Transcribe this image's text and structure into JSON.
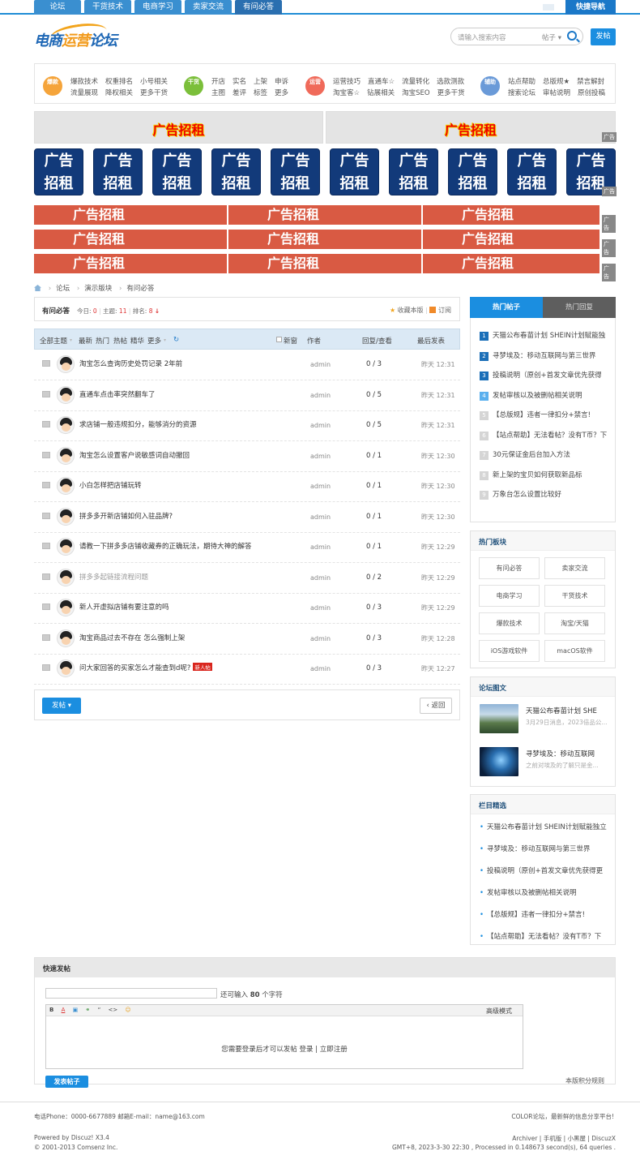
{
  "topnav": {
    "items": [
      "论坛",
      "干货技术",
      "电商学习",
      "卖家交流",
      "有问必答"
    ],
    "quick": "快捷导航"
  },
  "header": {
    "logo_part1": "电商",
    "logo_part2": "运营",
    "logo_part3": "论坛",
    "search_placeholder": "请输入搜索内容",
    "search_scope": "帖子 ▾",
    "post_button": "发帖"
  },
  "categories": [
    {
      "badge": "爆款",
      "color": "#f5a43a",
      "links": [
        "爆款技术",
        "权重排名",
        "小号相关",
        "流量展现",
        "降权相关",
        "更多干货"
      ]
    },
    {
      "badge": "干货",
      "color": "#7bbf3a",
      "links": [
        "开店",
        "实名",
        "上架",
        "申诉",
        "主图",
        "差评",
        "标签",
        "更多"
      ]
    },
    {
      "badge": "运营",
      "color": "#f06a5a",
      "links": [
        "运营技巧",
        "直通车☆",
        "流量转化",
        "选款测款",
        "淘宝客☆",
        "钻展相关",
        "淘宝SEO",
        "更多干货"
      ]
    },
    {
      "badge": "辅助",
      "color": "#6a9ad8",
      "links": [
        "站点帮助",
        "总版规★",
        "禁言解封",
        "搜索论坛",
        "审帖说明",
        "原创投稿"
      ]
    }
  ],
  "ads": {
    "text": "广告招租",
    "sq_line1": "广告",
    "sq_line2": "招租",
    "tag": "广告"
  },
  "breadcrumb": [
    "论坛",
    "演示版块",
    "有问必答"
  ],
  "forum": {
    "name": "有问必答",
    "today_label": "今日:",
    "today": "0",
    "topics_label": "主题:",
    "topics": "11",
    "rank_label": "排名:",
    "rank": "8",
    "fav": "收藏本版",
    "rss": "订阅"
  },
  "thead": {
    "all": "全部主题",
    "latest": "最新",
    "hot": "热门",
    "hotpost": "热帖",
    "digest": "精华",
    "more": "更多",
    "newwin": "新窗",
    "author": "作者",
    "reply_view": "回复/查看",
    "lastpost": "最后发表"
  },
  "threads": [
    {
      "title": "淘宝怎么查询历史处罚记录 2年前",
      "author": "admin",
      "rv": "0 / 3",
      "time": "昨天 12:31"
    },
    {
      "title": "直通车点击率突然翻车了",
      "author": "admin",
      "rv": "0 / 5",
      "time": "昨天 12:31"
    },
    {
      "title": "求店铺一般违规扣分，能够消分的资源",
      "author": "admin",
      "rv": "0 / 5",
      "time": "昨天 12:31"
    },
    {
      "title": "淘宝怎么设置客户说敏感词自动撤回",
      "author": "admin",
      "rv": "0 / 1",
      "time": "昨天 12:30"
    },
    {
      "title": "小白怎样把店铺玩转",
      "author": "admin",
      "rv": "0 / 1",
      "time": "昨天 12:30"
    },
    {
      "title": "拼多多开新店铺如何入驻品牌?",
      "author": "admin",
      "rv": "0 / 1",
      "time": "昨天 12:30"
    },
    {
      "title": "请教一下拼多多店铺收藏券的正确玩法，期待大神的解答",
      "author": "admin",
      "rv": "0 / 1",
      "time": "昨天 12:29"
    },
    {
      "title": "拼多多起链接流程问题",
      "author": "admin",
      "rv": "0 / 2",
      "time": "昨天 12:29"
    },
    {
      "title": "新人开虚拟店铺有要注意的吗",
      "author": "admin",
      "rv": "0 / 3",
      "time": "昨天 12:29"
    },
    {
      "title": "淘宝商品过去不存在 怎么强制上架",
      "author": "admin",
      "rv": "0 / 3",
      "time": "昨天 12:28"
    },
    {
      "title": "问大家回答的买家怎么才能查到d呢?",
      "author": "admin",
      "rv": "0 / 3",
      "time": "昨天 12:27",
      "badge": "新人帖"
    }
  ],
  "pager": {
    "post": "发帖 ▾",
    "back": "返回"
  },
  "sidebar": {
    "tab_hot": "热门帖子",
    "tab_reply": "热门回复",
    "hot": [
      "天猫公布春苗计划 SHEIN计划赋能独",
      "寻梦埃及：移动互联网与第三世界",
      "投稿说明（原创+首发文章优先获得",
      "发帖审核以及被删帖相关说明",
      "【总版规】违者一律扣分+禁言!",
      "【站点帮助】无法看帖？没有T币？下",
      "30元保证金后台加入方法",
      "新上架的宝贝如何获取新品标",
      "万象台怎么设置比较好"
    ],
    "boards_title": "热门板块",
    "boards": [
      "有问必答",
      "卖家交流",
      "电商学习",
      "干货技术",
      "爆款技术",
      "淘宝/天猫",
      "iOS游戏软件",
      "macOS软件"
    ],
    "pics_title": "论坛图文",
    "pics": [
      {
        "title": "天猫公布春苗计划 SHE",
        "desc": "3月29日消息，2023倍品公..."
      },
      {
        "title": "寻梦埃及：移动互联网",
        "desc": "之前对埃及的了解只是金..."
      }
    ],
    "col_title": "栏目精选",
    "col": [
      "天猫公布春苗计划 SHEIN计划赋能独立",
      "寻梦埃及：移动互联网与第三世界",
      "投稿说明（原创+首发文章优先获得更",
      "发帖审核以及被删帖相关说明",
      "【总版规】违者一律扣分+禁言!",
      "【站点帮助】无法看帖？没有T币？下"
    ]
  },
  "quickpost": {
    "title": "快速发帖",
    "count_prefix": "还可输入",
    "count": "80",
    "count_suffix": "个字符",
    "tools": [
      "B",
      "A",
      "▣",
      "⚭",
      "“",
      "<>",
      "☺"
    ],
    "mode": "高级模式",
    "msg": "您需要登录后才可以发帖 登录 | 立即注册",
    "submit": "发表帖子",
    "rule": "本版积分规则"
  },
  "footer": {
    "phone": "电话Phone：0000-6677889    邮箱E-mail：name@163.com",
    "slogan": "COLOR论坛，最新鲜的信息分享平台!",
    "powered": "Powered by Discuz! X3.4",
    "copyright": "© 2001-2013 Comsenz Inc.",
    "links": "Archiver | 手机版 | 小黑屋 | DiscuzX",
    "stats": "GMT+8, 2023-3-30 22:30 , Processed in 0.148673 second(s), 64 queries ."
  }
}
